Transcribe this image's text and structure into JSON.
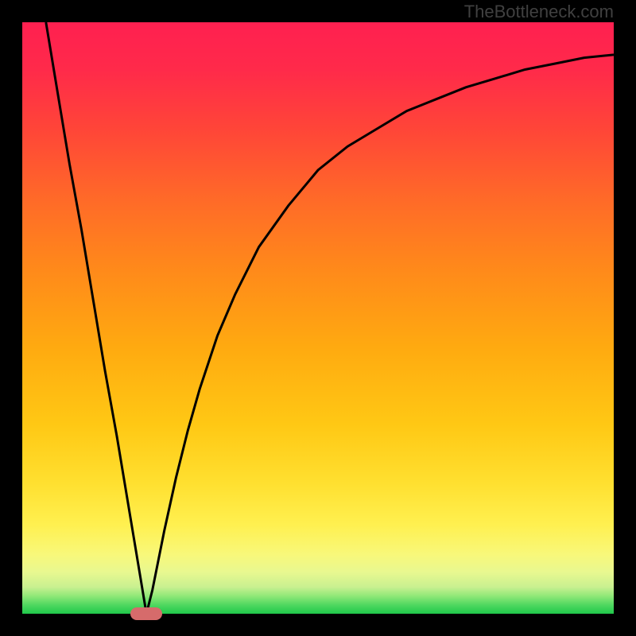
{
  "watermark": "TheBottleneck.com",
  "chart_data": {
    "type": "line",
    "title": "",
    "xlabel": "",
    "ylabel": "",
    "description": "Bottleneck curve showing optimal point (minimum) with V-shaped curve on gradient background from red (high bottleneck) through orange/yellow to green (low bottleneck)",
    "x_range": [
      0,
      100
    ],
    "y_range": [
      0,
      100
    ],
    "optimal_x": 21,
    "curve_points": [
      {
        "x": 4,
        "y": 100
      },
      {
        "x": 6,
        "y": 88
      },
      {
        "x": 8,
        "y": 76
      },
      {
        "x": 10,
        "y": 65
      },
      {
        "x": 12,
        "y": 53
      },
      {
        "x": 14,
        "y": 41
      },
      {
        "x": 16,
        "y": 30
      },
      {
        "x": 18,
        "y": 18
      },
      {
        "x": 20,
        "y": 6
      },
      {
        "x": 21,
        "y": 0
      },
      {
        "x": 22,
        "y": 4
      },
      {
        "x": 24,
        "y": 14
      },
      {
        "x": 26,
        "y": 23
      },
      {
        "x": 28,
        "y": 31
      },
      {
        "x": 30,
        "y": 38
      },
      {
        "x": 33,
        "y": 47
      },
      {
        "x": 36,
        "y": 54
      },
      {
        "x": 40,
        "y": 62
      },
      {
        "x": 45,
        "y": 69
      },
      {
        "x": 50,
        "y": 75
      },
      {
        "x": 55,
        "y": 79
      },
      {
        "x": 60,
        "y": 82
      },
      {
        "x": 65,
        "y": 85
      },
      {
        "x": 70,
        "y": 87
      },
      {
        "x": 75,
        "y": 89
      },
      {
        "x": 80,
        "y": 90.5
      },
      {
        "x": 85,
        "y": 92
      },
      {
        "x": 90,
        "y": 93
      },
      {
        "x": 95,
        "y": 94
      },
      {
        "x": 100,
        "y": 94.5
      }
    ],
    "gradient_colors": {
      "top": "#ff1744",
      "upper_mid": "#ff5722",
      "mid": "#ff9800",
      "lower_mid": "#ffc107",
      "lower": "#ffeb3b",
      "near_bottom": "#cddc39",
      "bottom": "#4caf50"
    },
    "marker": {
      "x": 21,
      "color": "#d66b6b"
    }
  }
}
